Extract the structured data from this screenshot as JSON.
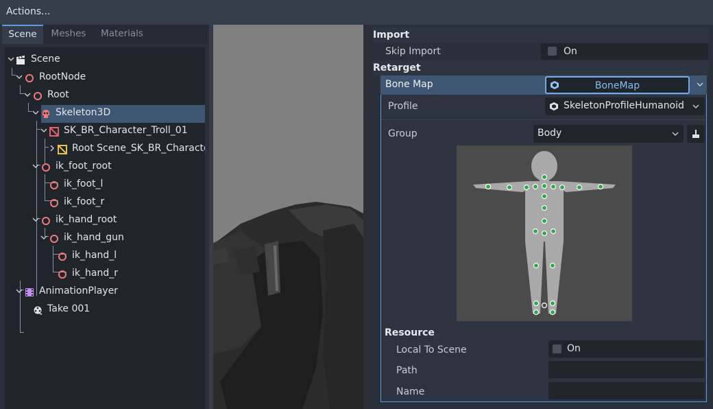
{
  "topbar": {
    "title": "Actions..."
  },
  "tabs": [
    {
      "label": "Scene",
      "active": true
    },
    {
      "label": "Meshes",
      "active": false
    },
    {
      "label": "Materials",
      "active": false
    }
  ],
  "tree": [
    {
      "label": "Scene",
      "icon": "clapper-icon"
    },
    {
      "label": "RootNode",
      "icon": "node3d-icon"
    },
    {
      "label": "Root",
      "icon": "node3d-icon"
    },
    {
      "label": "Skeleton3D",
      "icon": "skeleton-icon",
      "selected": true
    },
    {
      "label": "SK_BR_Character_Troll_01",
      "icon": "mesh-icon"
    },
    {
      "label": "Root Scene_SK_BR_Character_",
      "icon": "mesh-icon"
    },
    {
      "label": "ik_foot_root",
      "icon": "node3d-icon"
    },
    {
      "label": "ik_foot_l",
      "icon": "node3d-icon"
    },
    {
      "label": "ik_foot_r",
      "icon": "node3d-icon"
    },
    {
      "label": "ik_hand_root",
      "icon": "node3d-icon"
    },
    {
      "label": "ik_hand_gun",
      "icon": "node3d-icon"
    },
    {
      "label": "ik_hand_l",
      "icon": "node3d-icon"
    },
    {
      "label": "ik_hand_r",
      "icon": "node3d-icon"
    },
    {
      "label": "AnimationPlayer",
      "icon": "film-icon"
    },
    {
      "label": "Take 001",
      "icon": "animation-icon"
    }
  ],
  "inspector": {
    "import_header": "Import",
    "skip_import_label": "Skip Import",
    "skip_import_value": "On",
    "retarget_header": "Retarget",
    "bone_map_label": "Bone Map",
    "bone_map_value": "BoneMap",
    "profile_label": "Profile",
    "profile_value": "SkeletonProfileHumanoid",
    "group_label": "Group",
    "group_value": "Body",
    "resource_header": "Resource",
    "local_to_scene_label": "Local To Scene",
    "local_to_scene_value": "On",
    "path_label": "Path",
    "path_value": "",
    "name_label": "Name",
    "name_value": ""
  },
  "colors": {
    "accent": "#5b9be1",
    "selection": "#3f5672",
    "node_red": "#f2777a",
    "mesh_red": "#e0616c",
    "bone_green": "#2aa84a"
  }
}
